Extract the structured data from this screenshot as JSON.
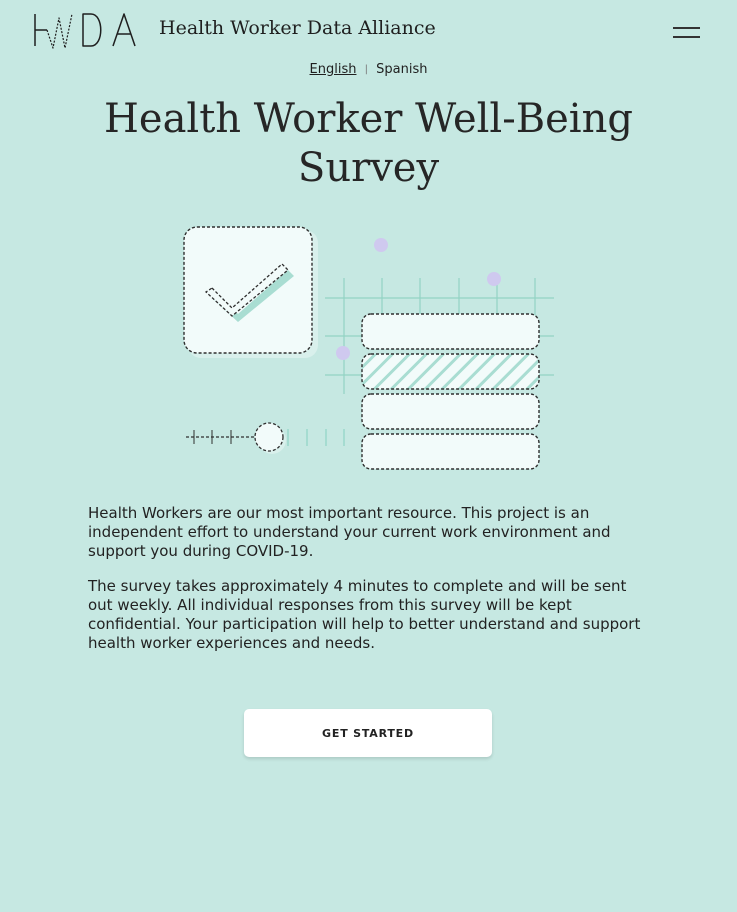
{
  "header": {
    "logo_text": "HWDA",
    "site_name": "Health Worker Data Alliance",
    "menu_icon": "hamburger-menu-icon"
  },
  "language": {
    "options": [
      "English",
      "Spanish"
    ],
    "selected": "English",
    "separator": "|"
  },
  "main": {
    "title": "Health Worker Well-Being Survey",
    "paragraphs": [
      "Health Workers are our most important resource. This project is an independent effort to understand your current work environment and support you during COVID-19.",
      "The survey takes approximately 4 minutes to complete and will be sent out weekly. All individual responses from this survey will be kept confidential. Your participation will help to better understand and support health worker experiences and needs."
    ],
    "cta_label": "GET STARTED"
  },
  "illustration": {
    "icons": [
      "checkbox-check-icon",
      "slider-icon",
      "form-stack-icon"
    ]
  },
  "colors": {
    "background": "#c6e8e2",
    "accent": "#8fd4c6",
    "dot": "#cfc9ef",
    "card": "#f2fbfa",
    "button": "#ffffff"
  }
}
